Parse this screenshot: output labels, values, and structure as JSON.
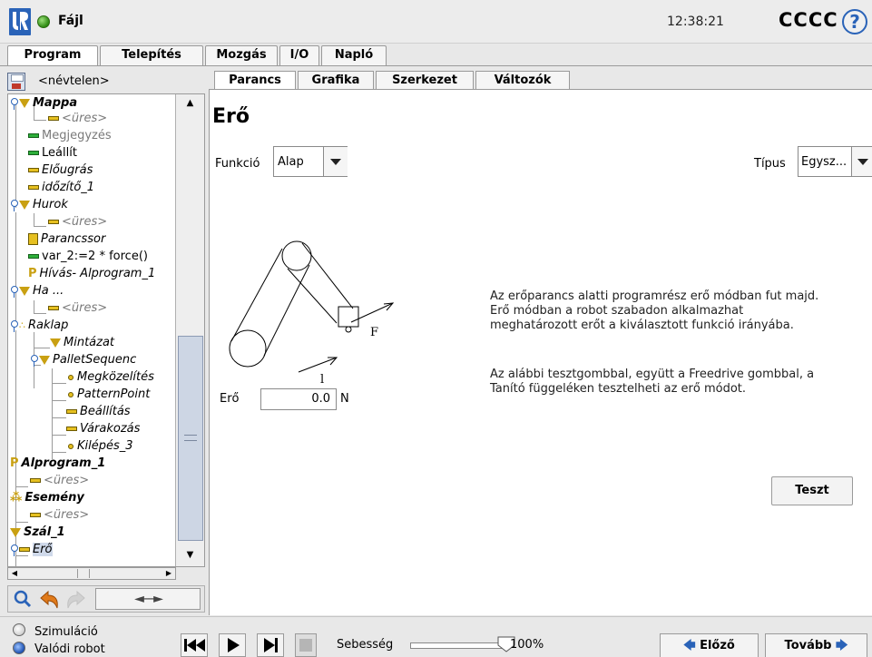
{
  "header": {
    "file_title": "Fájl",
    "clock": "12:38:21",
    "robot_name": "CCCC",
    "help_symbol": "?"
  },
  "main_tabs": [
    {
      "label": "Program",
      "active": true
    },
    {
      "label": "Telepítés",
      "active": false
    },
    {
      "label": "Mozgás",
      "active": false
    },
    {
      "label": "I/O",
      "active": false
    },
    {
      "label": "Napló",
      "active": false
    }
  ],
  "program": {
    "name": "<névtelen>"
  },
  "tree": [
    {
      "label": "Mappa",
      "style": "bold-italic"
    },
    {
      "label": "<üres>",
      "style": "gray-italic"
    },
    {
      "label": "Megjegyzés",
      "style": "gray"
    },
    {
      "label": "Leállít",
      "style": "normal"
    },
    {
      "label": "Előugrás",
      "style": "italic"
    },
    {
      "label": "időzítő_1",
      "style": "italic"
    },
    {
      "label": "Hurok",
      "style": "italic"
    },
    {
      "label": "<üres>",
      "style": "gray-italic"
    },
    {
      "label": "Parancssor",
      "style": "italic"
    },
    {
      "label": "var_2:=2 * force()",
      "style": "normal"
    },
    {
      "label": "Hívás- Alprogram_1",
      "style": "italic"
    },
    {
      "label": "Ha ...",
      "style": "italic"
    },
    {
      "label": "<üres>",
      "style": "gray-italic"
    },
    {
      "label": "Raklap",
      "style": "italic"
    },
    {
      "label": "Mintázat",
      "style": "italic"
    },
    {
      "label": "PalletSequenc",
      "style": "italic"
    },
    {
      "label": "Megközelítés",
      "style": "italic"
    },
    {
      "label": "PatternPoint",
      "style": "italic"
    },
    {
      "label": "Beállítás",
      "style": "italic"
    },
    {
      "label": "Várakozás",
      "style": "italic"
    },
    {
      "label": "Kilépés_3",
      "style": "italic"
    },
    {
      "label": "Alprogram_1",
      "style": "bold-italic"
    },
    {
      "label": "<üres>",
      "style": "gray-italic"
    },
    {
      "label": "Esemény",
      "style": "bold-italic"
    },
    {
      "label": "<üres>",
      "style": "gray-italic"
    },
    {
      "label": "Szál_1",
      "style": "bold-italic"
    },
    {
      "label": "Erő",
      "style": "italic"
    }
  ],
  "tools": {
    "move_label": "◄----►"
  },
  "sub_tabs": [
    {
      "label": "Parancs",
      "active": true
    },
    {
      "label": "Grafika",
      "active": false
    },
    {
      "label": "Szerkezet",
      "active": false
    },
    {
      "label": "Változók",
      "active": false
    }
  ],
  "command": {
    "title": "Erő",
    "function_label": "Funkció",
    "function_value": "Alap",
    "type_label": "Típus",
    "type_value": "Egysz...",
    "force_label": "Erő",
    "force_value": "0.0",
    "force_unit": "N",
    "diagram_labels": {
      "force": "F",
      "length": "l"
    },
    "description_1": "Az erőparancs alatti programrész erő módban fut majd. Erő módban a robot szabadon alkalmazhat meghatározott erőt a kiválasztott funkció irányába.",
    "description_2": "Az alábbi tesztgombbal, együtt a Freedrive gombbal, a Tanító függeléken tesztelheti az erő módot.",
    "test_button": "Teszt"
  },
  "footer": {
    "simulation_label": "Szimuláció",
    "real_robot_label": "Valódi robot",
    "speed_label": "Sebesség",
    "speed_value": "100%",
    "speed_fraction": 1.0,
    "prev_label": "Előző",
    "next_label": "Tovább"
  },
  "colors": {
    "accent_blue": "#2a63b8",
    "status_green": "#2e8a12",
    "mark_yellow": "#e6c020",
    "mark_green": "#2dae3a"
  }
}
